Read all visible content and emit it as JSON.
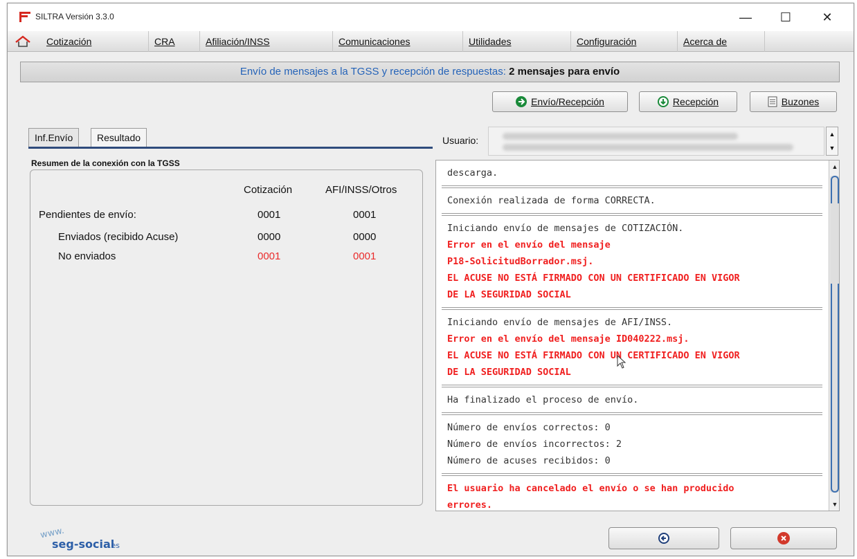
{
  "window": {
    "title": "SILTRA Versión 3.3.0",
    "controls": {
      "minimize": "—",
      "maximize": "☐",
      "close": "✕"
    }
  },
  "menu": {
    "items": [
      "Cotización",
      "CRA",
      "Afiliación/INSS",
      "Comunicaciones",
      "Utilidades",
      "Configuración",
      "Acerca de"
    ]
  },
  "header": {
    "text": "Envío de mensajes a la TGSS y recepción de respuestas:",
    "bold": "2 mensajes para envío"
  },
  "toolbar": {
    "envio_recepcion": "Envío/Recepción",
    "recepcion": "Recepción",
    "buzones": "Buzones"
  },
  "tabs": [
    "Inf.Envío",
    "Resultado"
  ],
  "summary": {
    "title": "Resumen de la conexión con la TGSS",
    "col_cotizacion": "Cotización",
    "col_afi": "AFI/INSS/Otros",
    "rows": [
      {
        "label": "Pendientes de envío:",
        "cot": "0001",
        "afi": "0001"
      },
      {
        "label": "Enviados (recibido Acuse)",
        "cot": "0000",
        "afi": "0000"
      },
      {
        "label": "No enviados",
        "cot": "0001",
        "afi": "0001"
      }
    ]
  },
  "user": {
    "label": "Usuario:"
  },
  "log": {
    "entries": [
      {
        "lines": [
          "descarga."
        ]
      },
      {
        "lines": [
          "Conexión realizada de forma CORRECTA."
        ]
      },
      {
        "lines": [
          "Iniciando envío de mensajes de COTIZACIÓN."
        ],
        "errors": [
          "Error en el envío del mensaje",
          "P18-SolicitudBorrador.msj.",
          "EL ACUSE NO ESTÁ FIRMADO CON UN CERTIFICADO EN VIGOR",
          "DE LA SEGURIDAD SOCIAL"
        ]
      },
      {
        "lines": [
          "Iniciando envío de mensajes de AFI/INSS."
        ],
        "errors": [
          "Error en el envío del mensaje ID040222.msj.",
          "EL ACUSE NO ESTÁ FIRMADO CON UN CERTIFICADO EN VIGOR",
          "DE LA SEGURIDAD SOCIAL"
        ]
      },
      {
        "lines": [
          "Ha finalizado el proceso de envío."
        ]
      },
      {
        "lines": [
          "Número de envíos correctos: 0",
          "Número de envíos incorrectos: 2",
          "Número de acuses recibidos: 0"
        ]
      },
      {
        "errors": [
          "El usuario ha cancelado el envío o se han producido",
          "errores."
        ]
      }
    ]
  },
  "brand": {
    "www": "www.",
    "name": "seg-social",
    "tld": ".es"
  },
  "colors": {
    "accent_blue": "#2563b8",
    "error_red": "#f01f1f",
    "tab_line": "#2f4b7c"
  }
}
